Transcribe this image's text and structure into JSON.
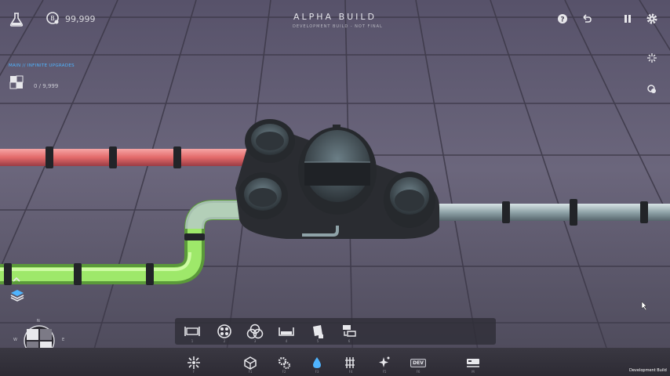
{
  "hud": {
    "currency_value": "99,999",
    "title": "ALPHA BUILD",
    "subtitle": "DEVELOPMENT BUILD - NOT FINAL",
    "upgrades_label": "MAIN // INFINITE UPGRADES",
    "upgrades_count": "0 / 9,999",
    "icons": {
      "research": "flask-icon",
      "currency": "coin-icon",
      "help": "help-icon",
      "undo": "undo-icon",
      "pause": "pause-icon",
      "settings": "gear-icon",
      "side_top": "sparkle-icon",
      "side_bottom": "map-pin-icon"
    }
  },
  "toolbar": {
    "items": [
      {
        "icon": "conveyor-icon",
        "key": "1"
      },
      {
        "icon": "balancer-icon",
        "key": "2"
      },
      {
        "icon": "cutter-icon",
        "key": "3"
      },
      {
        "icon": "trash-icon",
        "key": "4"
      },
      {
        "icon": "painter-icon",
        "key": "5"
      },
      {
        "icon": "stacker-icon",
        "key": "6"
      }
    ]
  },
  "bottom_bar": {
    "items": [
      {
        "icon": "hub-icon",
        "key": "F"
      },
      {
        "icon": "shapes-icon",
        "key": "F1"
      },
      {
        "icon": "gears-icon",
        "key": "F2"
      },
      {
        "icon": "fluid-icon",
        "key": "F3",
        "active": true
      },
      {
        "icon": "trains-icon",
        "key": "F4"
      },
      {
        "icon": "sparkle-icon",
        "key": "F5"
      },
      {
        "icon": "dev-icon",
        "key": "F6",
        "label": "DEV"
      },
      {
        "icon": "train-icon",
        "key": "M"
      }
    ],
    "dev_build": "Development Build"
  },
  "compass": {
    "n": "N",
    "s": "S",
    "e": "E",
    "w": "W"
  },
  "colors": {
    "accent": "#4fb4ff",
    "pipe_red": "#e36a6a",
    "pipe_green": "#9ee86a",
    "pipe_gray": "#8fa3a8"
  }
}
